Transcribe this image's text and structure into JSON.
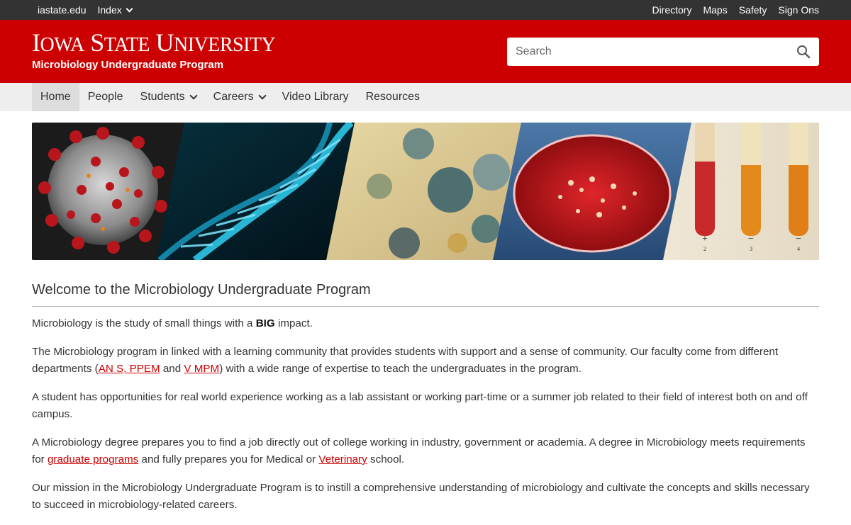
{
  "utility": {
    "left": [
      {
        "label": "iastate.edu"
      },
      {
        "label": "Index"
      }
    ],
    "right": [
      {
        "label": "Directory"
      },
      {
        "label": "Maps"
      },
      {
        "label": "Safety"
      },
      {
        "label": "Sign Ons"
      }
    ]
  },
  "header": {
    "wordmark": "Iowa State University",
    "site_name": "Microbiology Undergraduate Program",
    "search_placeholder": "Search"
  },
  "nav": {
    "items": [
      {
        "label": "Home",
        "active": true
      },
      {
        "label": "People"
      },
      {
        "label": "Students",
        "dropdown": true
      },
      {
        "label": "Careers",
        "dropdown": true
      },
      {
        "label": "Video Library"
      },
      {
        "label": "Resources"
      }
    ]
  },
  "hero": {
    "panels": [
      "coronavirus",
      "dna-helix",
      "mold-colonies",
      "petri-dish",
      "test-tubes"
    ],
    "tube_labels": [
      "+",
      "−",
      "−"
    ],
    "tube_numbers": [
      "2",
      "3",
      "4"
    ]
  },
  "content": {
    "title": "Welcome to the Microbiology Undergraduate Program",
    "p1": {
      "before": "Microbiology is the study of small things with a ",
      "bold": "BIG",
      "after": " impact."
    },
    "p2": {
      "t1": "The Microbiology program in linked with a learning community that provides students with support and a sense of community. Our faculty come from different departments (",
      "link1": "AN S, PPEM",
      "t2": " and ",
      "link2": "V MPM",
      "t3": ") with a wide range of expertise to teach the undergraduates in the program."
    },
    "p3": "A student has opportunities for real world experience working as a lab assistant or working part-time or a summer job related to their field of interest both on and off campus.",
    "p4": {
      "t1": "A Microbiology degree prepares you to find a job directly out of college working in industry, government or academia. A degree in Microbiology meets requirements for ",
      "link1": "graduate programs",
      "t2": " and fully prepares you for Medical or ",
      "link2": "Veterinary",
      "t3": " school."
    },
    "p5": "Our mission in the Microbiology Undergraduate Program is to instill a comprehensive understanding of microbiology and cultivate the concepts and skills necessary to succeed in microbiology-related careers."
  },
  "colors": {
    "brand_red": "#cc0000",
    "utility_bar": "#333333",
    "nav_bg": "#eeeeee",
    "nav_active": "#dddddd",
    "link": "#cc0000"
  }
}
